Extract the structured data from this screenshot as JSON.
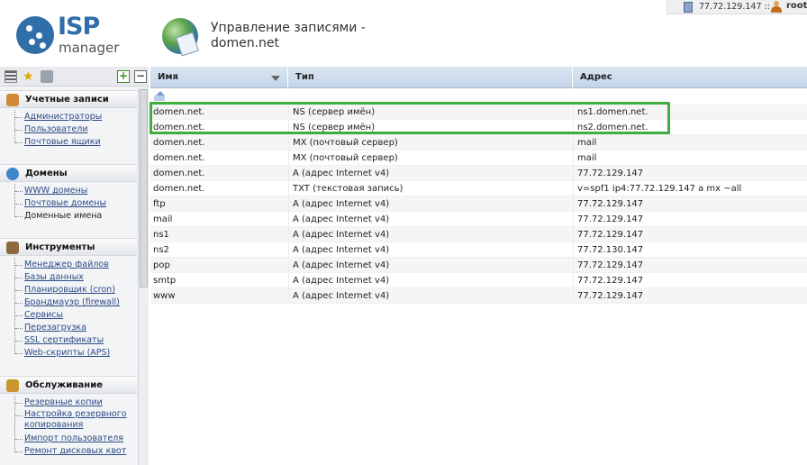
{
  "header": {
    "logo_primary": "ISP",
    "logo_secondary": "manager",
    "title_line1": "Управление записями -",
    "title_line2": "domen.net"
  },
  "userbar": {
    "server": "77.72.129.147 ::",
    "user": "root"
  },
  "sidebar": {
    "sections": [
      {
        "title": "Учетные записи",
        "icon": "users-icon",
        "items": [
          "Администраторы",
          "Пользователи",
          "Почтовые ящики"
        ]
      },
      {
        "title": "Домены",
        "icon": "globe-icon",
        "items": [
          "WWW домены",
          "Почтовые домены",
          "Доменные имена"
        ]
      },
      {
        "title": "Инструменты",
        "icon": "tools-icon",
        "items": [
          "Менеджер файлов",
          "Базы данных",
          "Планировщик (cron)",
          "Брандмауэр (firewall)",
          "Сервисы",
          "Перезагрузка",
          "SSL сертификаты",
          "Web-скрипты (APS)"
        ]
      },
      {
        "title": "Обслуживание",
        "icon": "maintenance-icon",
        "items": [
          "Резервные копии",
          "Настройка резервного копирования",
          "Импорт пользователя",
          "Ремонт дисковых квот"
        ]
      }
    ]
  },
  "table": {
    "columns": [
      "Имя",
      "Тип",
      "Адрес"
    ],
    "rows": [
      [
        "domen.net.",
        "NS (сервер имён)",
        "ns1.domen.net."
      ],
      [
        "domen.net.",
        "NS (сервер имён)",
        "ns2.domen.net."
      ],
      [
        "domen.net.",
        "MX (почтовый сервер)",
        "mail"
      ],
      [
        "domen.net.",
        "MX (почтовый сервер)",
        "mail"
      ],
      [
        "domen.net.",
        "A (адрес Internet v4)",
        "77.72.129.147"
      ],
      [
        "domen.net.",
        "TXT (текстовая запись)",
        "v=spf1 ip4:77.72.129.147 a mx ~all"
      ],
      [
        "ftp",
        "A (адрес Internet v4)",
        "77.72.129.147"
      ],
      [
        "mail",
        "A (адрес Internet v4)",
        "77.72.129.147"
      ],
      [
        "ns1",
        "A (адрес Internet v4)",
        "77.72.129.147"
      ],
      [
        "ns2",
        "A (адрес Internet v4)",
        "77.72.130.147"
      ],
      [
        "pop",
        "A (адрес Internet v4)",
        "77.72.129.147"
      ],
      [
        "smtp",
        "A (адрес Internet v4)",
        "77.72.129.147"
      ],
      [
        "www",
        "A (адрес Internet v4)",
        "77.72.129.147"
      ]
    ]
  },
  "colors": {
    "brand": "#2f6ea8",
    "highlight": "#3fae3f",
    "header_bg": "#c3d4e8",
    "link": "#2b4b86"
  }
}
